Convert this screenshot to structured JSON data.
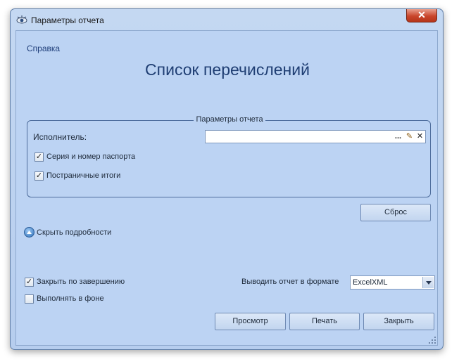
{
  "window": {
    "title": "Параметры отчета",
    "close_glyph": "✕"
  },
  "help_link": "Справка",
  "page_title": "Список перечислений",
  "params": {
    "legend": "Параметры отчета",
    "executor_label": "Исполнитель:",
    "executor_value": "",
    "executor_buttons": [
      "...",
      "✎",
      "✕"
    ],
    "checkboxes": [
      {
        "label": "Серия и номер паспорта",
        "checked": true
      },
      {
        "label": "Постраничные итоги",
        "checked": true
      }
    ]
  },
  "reset_button": "Сброс",
  "details_link": "Скрыть подробности",
  "options": [
    {
      "label": "Закрыть по завершению",
      "checked": true
    },
    {
      "label": "Выполнять в фоне",
      "checked": false
    }
  ],
  "format": {
    "label": "Выводить отчет в формате",
    "value": "ExcelXML"
  },
  "buttons": {
    "preview": "Просмотр",
    "print": "Печать",
    "close": "Закрыть"
  },
  "icons": {
    "app": "eye-icon",
    "close": "close-icon",
    "ellipsis": "ellipsis-icon",
    "edit": "edit-icon",
    "clear": "clear-icon",
    "collapse": "collapse-up-icon",
    "dropdown": "chevron-down-icon",
    "resize": "resize-grip-icon"
  },
  "colors": {
    "title": "#1f3e73",
    "window_bg": "#bcd3f3",
    "close_button": "#c9462c"
  }
}
